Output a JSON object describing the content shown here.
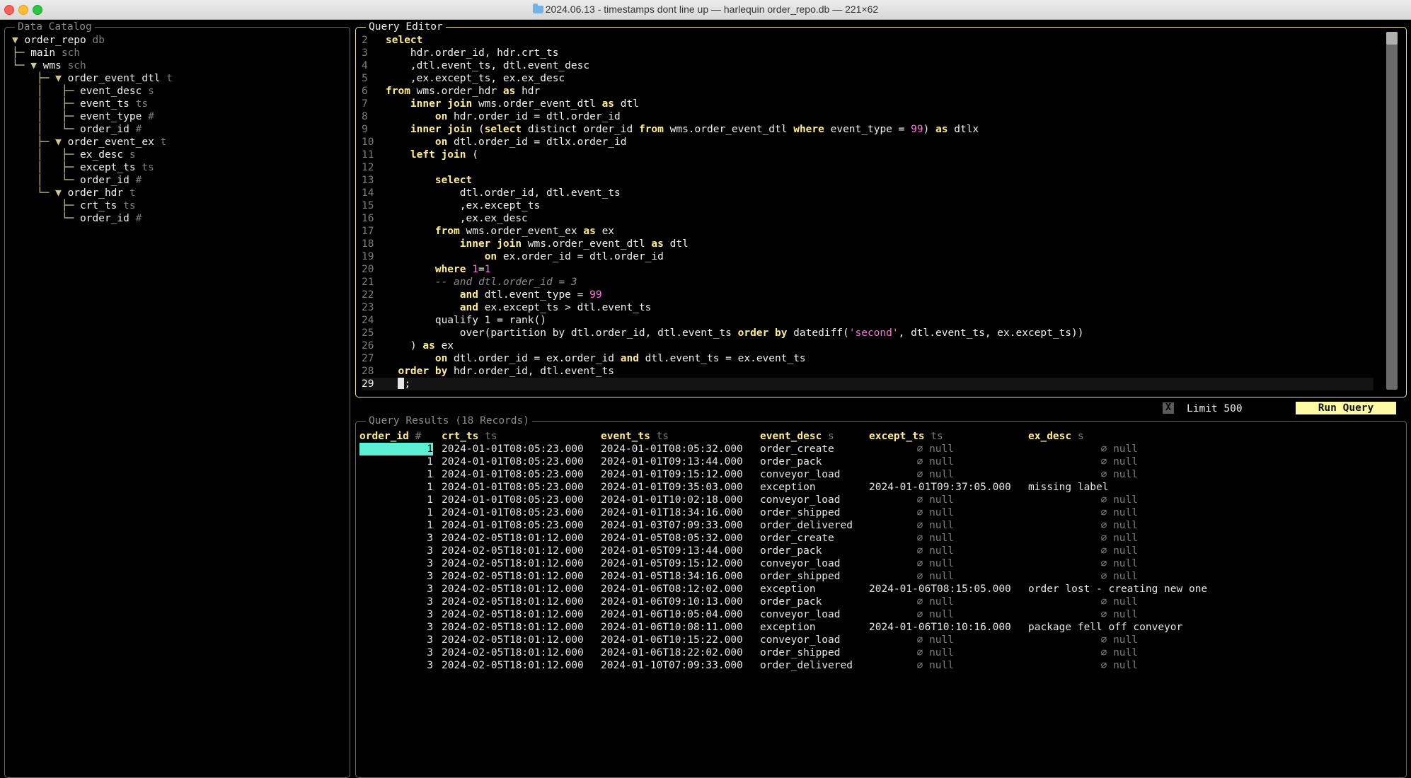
{
  "window": {
    "title": "2024.06.13 - timestamps dont line up — harlequin order_repo.db — 221×62"
  },
  "catalog": {
    "title": "Data Catalog",
    "tree": [
      {
        "guide": "▼ ",
        "name": "order_repo",
        "tag": "db"
      },
      {
        "guide": "├─ ",
        "name": "main",
        "tag": "sch"
      },
      {
        "guide": "└─ ▼ ",
        "name": "wms",
        "tag": "sch"
      },
      {
        "guide": "    ├─ ▼ ",
        "name": "order_event_dtl",
        "tag": "t"
      },
      {
        "guide": "    │   ├─ ",
        "name": "event_desc",
        "tag": "s"
      },
      {
        "guide": "    │   ├─ ",
        "name": "event_ts",
        "tag": "ts"
      },
      {
        "guide": "    │   ├─ ",
        "name": "event_type",
        "tag": "#"
      },
      {
        "guide": "    │   └─ ",
        "name": "order_id",
        "tag": "#"
      },
      {
        "guide": "    ├─ ▼ ",
        "name": "order_event_ex",
        "tag": "t"
      },
      {
        "guide": "    │   ├─ ",
        "name": "ex_desc",
        "tag": "s"
      },
      {
        "guide": "    │   ├─ ",
        "name": "except_ts",
        "tag": "ts"
      },
      {
        "guide": "    │   └─ ",
        "name": "order_id",
        "tag": "#"
      },
      {
        "guide": "    └─ ▼ ",
        "name": "order_hdr",
        "tag": "t"
      },
      {
        "guide": "        ├─ ",
        "name": "crt_ts",
        "tag": "ts"
      },
      {
        "guide": "        └─ ",
        "name": "order_id",
        "tag": "#"
      }
    ]
  },
  "editor": {
    "title": "Query Editor",
    "current_line": "29",
    "lines": [
      {
        "n": "2",
        "tokens": [
          {
            "t": "kw",
            "v": "select"
          }
        ]
      },
      {
        "n": "3",
        "tokens": [
          {
            "t": "ct",
            "v": "    hdr.order_id, hdr.crt_ts"
          }
        ]
      },
      {
        "n": "4",
        "tokens": [
          {
            "t": "ct",
            "v": "    ,dtl.event_ts, dtl.event_desc"
          }
        ]
      },
      {
        "n": "5",
        "tokens": [
          {
            "t": "ct",
            "v": "    ,ex.except_ts, ex.ex_desc"
          }
        ]
      },
      {
        "n": "6",
        "tokens": [
          {
            "t": "kw",
            "v": "from"
          },
          {
            "t": "ct",
            "v": " wms.order_hdr "
          },
          {
            "t": "kw",
            "v": "as"
          },
          {
            "t": "ct",
            "v": " hdr"
          }
        ]
      },
      {
        "n": "7",
        "tokens": [
          {
            "t": "ct",
            "v": "    "
          },
          {
            "t": "kw",
            "v": "inner join"
          },
          {
            "t": "ct",
            "v": " wms.order_event_dtl "
          },
          {
            "t": "kw",
            "v": "as"
          },
          {
            "t": "ct",
            "v": " dtl"
          }
        ]
      },
      {
        "n": "8",
        "tokens": [
          {
            "t": "ct",
            "v": "        "
          },
          {
            "t": "kw",
            "v": "on"
          },
          {
            "t": "ct",
            "v": " hdr.order_id = dtl.order_id"
          }
        ]
      },
      {
        "n": "9",
        "tokens": [
          {
            "t": "ct",
            "v": "    "
          },
          {
            "t": "kw",
            "v": "inner join"
          },
          {
            "t": "ct",
            "v": " ("
          },
          {
            "t": "kw",
            "v": "select"
          },
          {
            "t": "ct",
            "v": " distinct order_id "
          },
          {
            "t": "kw",
            "v": "from"
          },
          {
            "t": "ct",
            "v": " wms.order_event_dtl "
          },
          {
            "t": "kw",
            "v": "where"
          },
          {
            "t": "ct",
            "v": " event_type = "
          },
          {
            "t": "num",
            "v": "99"
          },
          {
            "t": "ct",
            "v": ") "
          },
          {
            "t": "kw",
            "v": "as"
          },
          {
            "t": "ct",
            "v": " dtlx"
          }
        ]
      },
      {
        "n": "10",
        "tokens": [
          {
            "t": "ct",
            "v": "        "
          },
          {
            "t": "kw",
            "v": "on"
          },
          {
            "t": "ct",
            "v": " dtl.order_id = dtlx.order_id"
          }
        ]
      },
      {
        "n": "11",
        "tokens": [
          {
            "t": "ct",
            "v": "    "
          },
          {
            "t": "kw",
            "v": "left join"
          },
          {
            "t": "ct",
            "v": " ("
          }
        ]
      },
      {
        "n": "12",
        "tokens": [
          {
            "t": "ct",
            "v": ""
          }
        ]
      },
      {
        "n": "13",
        "tokens": [
          {
            "t": "ct",
            "v": "        "
          },
          {
            "t": "kw",
            "v": "select"
          }
        ]
      },
      {
        "n": "14",
        "tokens": [
          {
            "t": "ct",
            "v": "            dtl.order_id, dtl.event_ts"
          }
        ]
      },
      {
        "n": "15",
        "tokens": [
          {
            "t": "ct",
            "v": "            ,ex.except_ts"
          }
        ]
      },
      {
        "n": "16",
        "tokens": [
          {
            "t": "ct",
            "v": "            ,ex.ex_desc"
          }
        ]
      },
      {
        "n": "17",
        "tokens": [
          {
            "t": "ct",
            "v": "        "
          },
          {
            "t": "kw",
            "v": "from"
          },
          {
            "t": "ct",
            "v": " wms.order_event_ex "
          },
          {
            "t": "kw",
            "v": "as"
          },
          {
            "t": "ct",
            "v": " ex"
          }
        ]
      },
      {
        "n": "18",
        "tokens": [
          {
            "t": "ct",
            "v": "            "
          },
          {
            "t": "kw",
            "v": "inner join"
          },
          {
            "t": "ct",
            "v": " wms.order_event_dtl "
          },
          {
            "t": "kw",
            "v": "as"
          },
          {
            "t": "ct",
            "v": " dtl"
          }
        ]
      },
      {
        "n": "19",
        "tokens": [
          {
            "t": "ct",
            "v": "                "
          },
          {
            "t": "kw",
            "v": "on"
          },
          {
            "t": "ct",
            "v": " ex.order_id = dtl.order_id"
          }
        ]
      },
      {
        "n": "20",
        "tokens": [
          {
            "t": "ct",
            "v": "        "
          },
          {
            "t": "kw",
            "v": "where"
          },
          {
            "t": "ct",
            "v": " "
          },
          {
            "t": "num",
            "v": "1"
          },
          {
            "t": "ct",
            "v": "="
          },
          {
            "t": "num",
            "v": "1"
          }
        ]
      },
      {
        "n": "21",
        "tokens": [
          {
            "t": "ct",
            "v": "        "
          },
          {
            "t": "cm",
            "v": "-- and dtl.order_id = 3"
          }
        ]
      },
      {
        "n": "22",
        "tokens": [
          {
            "t": "ct",
            "v": "            "
          },
          {
            "t": "kw",
            "v": "and"
          },
          {
            "t": "ct",
            "v": " dtl.event_type = "
          },
          {
            "t": "num",
            "v": "99"
          }
        ]
      },
      {
        "n": "23",
        "tokens": [
          {
            "t": "ct",
            "v": "            "
          },
          {
            "t": "kw",
            "v": "and"
          },
          {
            "t": "ct",
            "v": " ex.except_ts > dtl.event_ts"
          }
        ]
      },
      {
        "n": "24",
        "tokens": [
          {
            "t": "ct",
            "v": "        qualify 1 = rank()"
          }
        ]
      },
      {
        "n": "25",
        "tokens": [
          {
            "t": "ct",
            "v": "            over(partition by dtl.order_id, dtl.event_ts "
          },
          {
            "t": "kw",
            "v": "order by"
          },
          {
            "t": "ct",
            "v": " datediff("
          },
          {
            "t": "str",
            "v": "'second'"
          },
          {
            "t": "ct",
            "v": ", dtl.event_ts, ex.except_ts))"
          }
        ]
      },
      {
        "n": "26",
        "tokens": [
          {
            "t": "ct",
            "v": "    ) "
          },
          {
            "t": "kw",
            "v": "as"
          },
          {
            "t": "ct",
            "v": " ex"
          }
        ]
      },
      {
        "n": "27",
        "tokens": [
          {
            "t": "ct",
            "v": "        "
          },
          {
            "t": "kw",
            "v": "on"
          },
          {
            "t": "ct",
            "v": " dtl.order_id = ex.order_id "
          },
          {
            "t": "kw",
            "v": "and"
          },
          {
            "t": "ct",
            "v": " dtl.event_ts = ex.event_ts"
          }
        ]
      },
      {
        "n": "28",
        "tokens": [
          {
            "t": "ct",
            "v": "  "
          },
          {
            "t": "kw",
            "v": "order by"
          },
          {
            "t": "ct",
            "v": " hdr.order_id, dtl.event_ts"
          }
        ]
      },
      {
        "n": "29",
        "tokens": [
          {
            "t": "ct",
            "v": "  "
          },
          {
            "t": "cursor",
            "v": ""
          },
          {
            "t": "ct",
            "v": ";"
          }
        ]
      }
    ]
  },
  "toolbar": {
    "limit_check": "X",
    "limit_label": "Limit 500",
    "run_label": "Run Query"
  },
  "results": {
    "title": "Query Results (18 Records)",
    "null_text": "∅ null",
    "columns": [
      {
        "name": "order_id",
        "tag": "#"
      },
      {
        "name": "crt_ts",
        "tag": "ts"
      },
      {
        "name": "event_ts",
        "tag": "ts"
      },
      {
        "name": "event_desc",
        "tag": "s"
      },
      {
        "name": "except_ts",
        "tag": "ts"
      },
      {
        "name": "ex_desc",
        "tag": "s"
      }
    ],
    "rows": [
      [
        "1",
        "2024-01-01T08:05:23.000",
        "2024-01-01T08:05:32.000",
        "order_create",
        null,
        null
      ],
      [
        "1",
        "2024-01-01T08:05:23.000",
        "2024-01-01T09:13:44.000",
        "order_pack",
        null,
        null
      ],
      [
        "1",
        "2024-01-01T08:05:23.000",
        "2024-01-01T09:15:12.000",
        "conveyor_load",
        null,
        null
      ],
      [
        "1",
        "2024-01-01T08:05:23.000",
        "2024-01-01T09:35:03.000",
        "exception",
        "2024-01-01T09:37:05.000",
        "missing label"
      ],
      [
        "1",
        "2024-01-01T08:05:23.000",
        "2024-01-01T10:02:18.000",
        "conveyor_load",
        null,
        null
      ],
      [
        "1",
        "2024-01-01T08:05:23.000",
        "2024-01-01T18:34:16.000",
        "order_shipped",
        null,
        null
      ],
      [
        "1",
        "2024-01-01T08:05:23.000",
        "2024-01-03T07:09:33.000",
        "order_delivered",
        null,
        null
      ],
      [
        "3",
        "2024-02-05T18:01:12.000",
        "2024-01-05T08:05:32.000",
        "order_create",
        null,
        null
      ],
      [
        "3",
        "2024-02-05T18:01:12.000",
        "2024-01-05T09:13:44.000",
        "order_pack",
        null,
        null
      ],
      [
        "3",
        "2024-02-05T18:01:12.000",
        "2024-01-05T09:15:12.000",
        "conveyor_load",
        null,
        null
      ],
      [
        "3",
        "2024-02-05T18:01:12.000",
        "2024-01-05T18:34:16.000",
        "order_shipped",
        null,
        null
      ],
      [
        "3",
        "2024-02-05T18:01:12.000",
        "2024-01-06T08:12:02.000",
        "exception",
        "2024-01-06T08:15:05.000",
        "order lost - creating new one"
      ],
      [
        "3",
        "2024-02-05T18:01:12.000",
        "2024-01-06T09:10:13.000",
        "order_pack",
        null,
        null
      ],
      [
        "3",
        "2024-02-05T18:01:12.000",
        "2024-01-06T10:05:04.000",
        "conveyor_load",
        null,
        null
      ],
      [
        "3",
        "2024-02-05T18:01:12.000",
        "2024-01-06T10:08:11.000",
        "exception",
        "2024-01-06T10:10:16.000",
        "package fell off conveyor"
      ],
      [
        "3",
        "2024-02-05T18:01:12.000",
        "2024-01-06T10:15:22.000",
        "conveyor_load",
        null,
        null
      ],
      [
        "3",
        "2024-02-05T18:01:12.000",
        "2024-01-06T18:22:02.000",
        "order_shipped",
        null,
        null
      ],
      [
        "3",
        "2024-02-05T18:01:12.000",
        "2024-01-10T07:09:33.000",
        "order_delivered",
        null,
        null
      ]
    ]
  }
}
